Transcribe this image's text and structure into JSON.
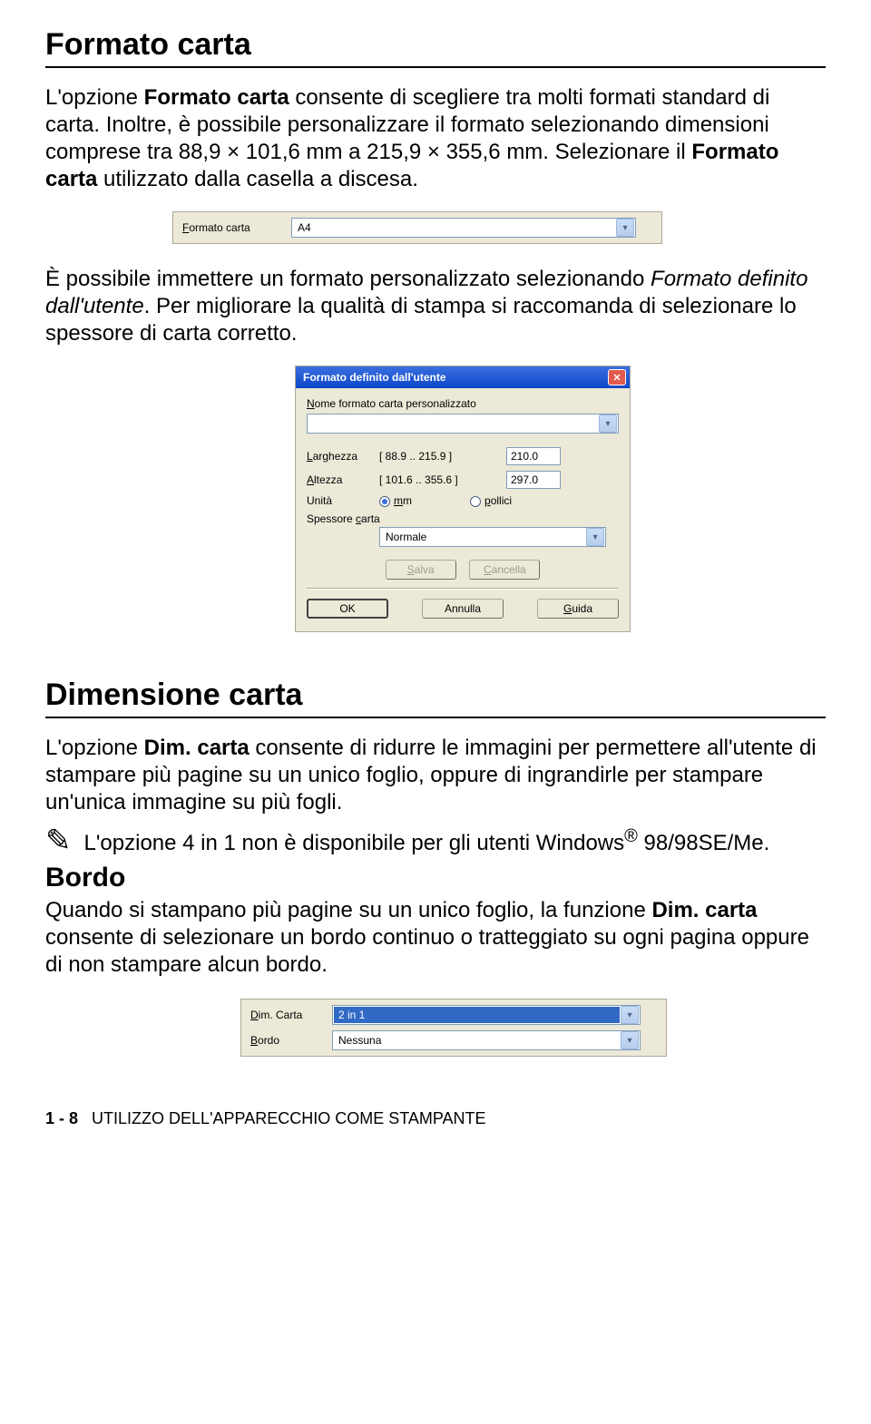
{
  "section1": {
    "heading": "Formato carta",
    "para1_a": "L'opzione ",
    "para1_b": "Formato carta",
    "para1_c": " consente di scegliere tra molti formati standard di carta. Inoltre, è possibile personalizzare il formato selezionando dimensioni comprese tra 88,9 × 101,6 mm a 215,9 × 355,6 mm. Selezionare il ",
    "para1_d": "Formato carta",
    "para1_e": " utilizzato dalla casella a discesa.",
    "para2_a": "È possibile immettere un formato personalizzato selezionando ",
    "para2_b": "Formato definito dall'utente",
    "para2_c": ". Per migliorare la qualità di stampa si raccomanda di selezionare lo spessore di carta corretto."
  },
  "fig1": {
    "label_pref": "F",
    "label_rest": "ormato carta",
    "value": "A4"
  },
  "dialog": {
    "title": "Formato definito dall'utente",
    "nome_pref": "N",
    "nome_rest": "ome formato carta personalizzato",
    "larghezza_pref": "L",
    "larghezza_rest": "arghezza",
    "larghezza_range": "[ 88.9    ..  215.9 ]",
    "larghezza_val": "210.0",
    "altezza_pref": "A",
    "altezza_rest": "ltezza",
    "altezza_range": "[ 101.6  ..  355.6 ]",
    "altezza_val": "297.0",
    "unita": "Unità",
    "mm_pref": "m",
    "mm_rest": "m",
    "pollici_pref": "p",
    "pollici_rest": "ollici",
    "spessore_pref1": "c",
    "spessore_a": "Spessore ",
    "spessore_b": "arta",
    "spessore_val": "Normale",
    "salva_pref": "S",
    "salva_rest": "alva",
    "cancella_pref": "C",
    "cancella_rest": "ancella",
    "ok": "OK",
    "annulla": "Annulla",
    "guida_pref": "G",
    "guida_rest": "uida"
  },
  "section2": {
    "heading": "Dimensione carta",
    "para_a": "L'opzione ",
    "para_b": "Dim. carta",
    "para_c": " consente di ridurre le immagini per permettere all'utente di stampare più pagine su un unico foglio, oppure di ingrandirle per stampare un'unica immagine su più fogli.",
    "note_a": "L'opzione 4 in 1 non è disponibile per gli utenti Windows",
    "note_sup": "®",
    "note_b": " 98/98SE/Me.",
    "bordo_heading": "Bordo",
    "bordo_a": "Quando si stampano più pagine su un unico foglio, la funzione ",
    "bordo_b": "Dim. carta",
    "bordo_c": " consente di selezionare un bordo continuo o tratteggiato su ogni pagina oppure di non stampare alcun bordo."
  },
  "fig3": {
    "dim_pref": "D",
    "dim_rest": "im. Carta",
    "dim_val": "2 in 1",
    "bordo_pref": "B",
    "bordo_rest": "ordo",
    "bordo_val": "Nessuna"
  },
  "footer": {
    "page": "1 - 8",
    "chapter": "UTILIZZO DELL'APPARECCHIO COME STAMPANTE"
  }
}
